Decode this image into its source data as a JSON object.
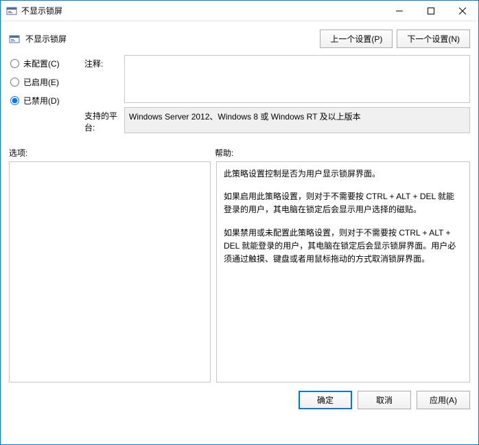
{
  "window": {
    "title": "不显示锁屏"
  },
  "header": {
    "title": "不显示锁屏",
    "prev_button": "上一个设置(P)",
    "next_button": "下一个设置(N)"
  },
  "radio": {
    "not_configured": "未配置(C)",
    "enabled": "已启用(E)",
    "disabled": "已禁用(D)",
    "selected": "disabled"
  },
  "fields": {
    "comment_label": "注释:",
    "comment_value": "",
    "platform_label": "支持的平台:",
    "platform_value": "Windows Server 2012、Windows 8 或 Windows RT 及以上版本"
  },
  "sections": {
    "options_label": "选项:",
    "help_label": "帮助:"
  },
  "help": {
    "p1": "此策略设置控制是否为用户显示锁屏界面。",
    "p2": "如果启用此策略设置，则对于不需要按 CTRL + ALT + DEL  就能登录的用户，其电脑在锁定后会显示用户选择的磁贴。",
    "p3": "如果禁用或未配置此策略设置，则对于不需要按 CTRL + ALT + DEL 就能登录的用户，其电脑在锁定后会显示锁屏界面。用户必须通过触摸、键盘或者用鼠标拖动的方式取消锁屏界面。"
  },
  "footer": {
    "ok": "确定",
    "cancel": "取消",
    "apply": "应用(A)"
  }
}
